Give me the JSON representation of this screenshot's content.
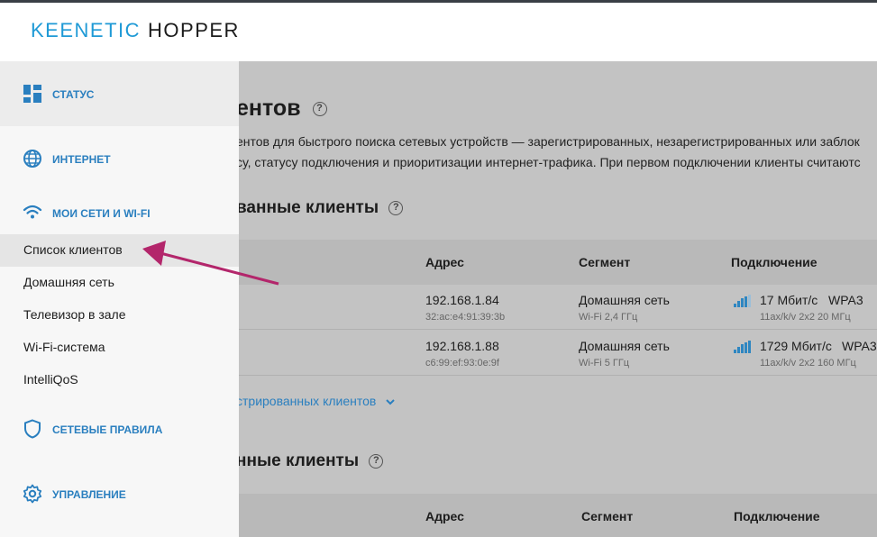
{
  "brand": {
    "part1": "KEENETIC",
    "part2": "HOPPER"
  },
  "sidebar": {
    "status": "СТАТУС",
    "internet": "ИНТЕРНЕТ",
    "networks": "МОИ СЕТИ И WI-FI",
    "sub_items": [
      "Список клиентов",
      "Домашняя сеть",
      "Телевизор в зале",
      "Wi-Fi-система",
      "IntelliQoS"
    ],
    "rules": "СЕТЕВЫЕ ПРАВИЛА",
    "management": "УПРАВЛЕНИЕ"
  },
  "main": {
    "title": "ентов",
    "desc_line1": "ентов для быстрого поиска сетевых устройств — зарегистрированных, незарегистрированных или заблок",
    "desc_line2": "су, статусу подключения и приоритизации интернет-трафика. При первом подключении клиенты считаютс",
    "registered_title": "ванные клиенты",
    "columns": {
      "address": "Адрес",
      "segment": "Сегмент",
      "connection": "Подключение"
    },
    "rows": [
      {
        "ip": "192.168.1.84",
        "mac": "32:ac:e4:91:39:3b",
        "segment": "Домашняя сеть",
        "band": "Wi-Fi 2,4 ГГц",
        "speed": "17 Мбит/с",
        "security": "WPA3",
        "mode": "11ax/k/v 2x2 20 МГц"
      },
      {
        "ip": "192.168.1.88",
        "mac": "c6:99:ef:93:0e:9f",
        "segment": "Домашняя сеть",
        "band": "Wi-Fi 5 ГГц",
        "speed": "1729 Мбит/с",
        "security": "WPA3",
        "mode": "11ax/k/v 2x2 160 МГц"
      }
    ],
    "more_link": "стрированных клиентов",
    "unregistered_title": "нные клиенты",
    "columns2": {
      "address": "Адрес",
      "segment": "Сегмент",
      "connection": "Подключение"
    }
  },
  "help_glyph": "?",
  "colors": {
    "accent": "#2a7fbf",
    "arrow": "#b3266b",
    "brand": "#1f9ad6"
  }
}
